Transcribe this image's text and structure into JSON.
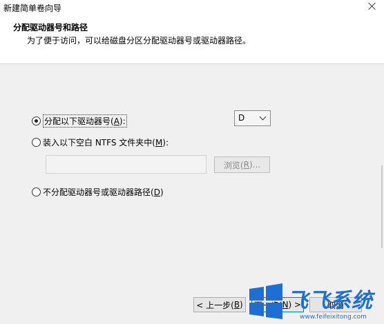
{
  "window": {
    "title": "新建简单卷向导"
  },
  "header": {
    "title": "分配驱动器号和路径",
    "subtitle": "为了便于访问，可以给磁盘分区分配驱动器号或驱动器路径。"
  },
  "options": {
    "assign_letter": {
      "label_pre": "分配以下驱动器号(",
      "accel": "A",
      "label_post": "):",
      "checked": true
    },
    "mount_folder": {
      "label_pre": "装入以下空白 NTFS 文件夹中(",
      "accel": "M",
      "label_post": "):",
      "checked": false
    },
    "no_assign": {
      "label_pre": "不分配驱动器号或驱动器路径(",
      "accel": "D",
      "label_post": ")",
      "checked": false
    }
  },
  "drive_select": {
    "value": "D"
  },
  "path_input": {
    "value": ""
  },
  "browse_button": {
    "label_pre": "浏览(",
    "accel": "R",
    "label_post": ")..."
  },
  "footer": {
    "back": {
      "label_pre": "< 上一步(",
      "accel": "B",
      "label_post": ")"
    },
    "next": {
      "label_pre": "下一步(",
      "accel": "N",
      "label_post": ") >"
    },
    "cancel": {
      "label": "取消"
    }
  },
  "watermark": {
    "brand": "飞飞系统",
    "url": "www.feifeixitong.com",
    "accent": "#1d6fd6"
  }
}
